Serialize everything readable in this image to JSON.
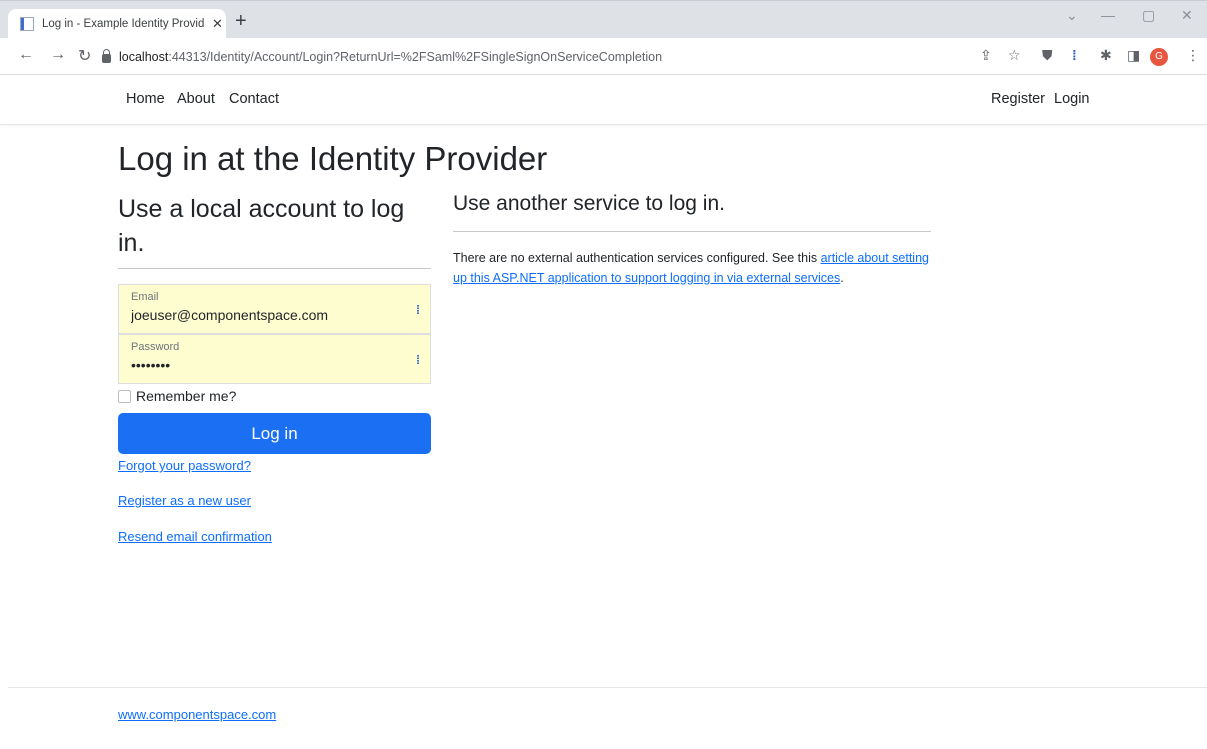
{
  "browser": {
    "tab_title": "Log in - Example Identity Provider",
    "tab_close": "✕",
    "new_tab": "+",
    "url_host": "localhost",
    "url_path": ":44313/Identity/Account/Login?ReturnUrl=%2FSaml%2FSingleSignOnServiceCompletion",
    "avatar_letter": "G",
    "icons": [
      "back-icon",
      "forward-icon",
      "reload-icon",
      "lock-icon",
      "share-icon",
      "star-icon",
      "shield-icon",
      "extension-icon",
      "puzzle-icon",
      "sidepanel-icon",
      "menu-icon"
    ]
  },
  "nav": {
    "home": "Home",
    "about": "About",
    "contact": "Contact",
    "register": "Register",
    "login": "Login"
  },
  "page": {
    "title": "Log in at the Identity Provider",
    "local_heading": "Use a local account to log in.",
    "external_heading": "Use another service to log in.",
    "email_label": "Email",
    "email_value": "joeuser@componentspace.com",
    "password_label": "Password",
    "password_value": "••••••••",
    "remember_label": "Remember me?",
    "login_button": "Log in",
    "forgot_link": "Forgot your password?",
    "register_link": "Register as a new user",
    "resend_link": "Resend email confirmation",
    "external_text": "There are no external authentication services configured. See this ",
    "external_link_1": "article",
    "external_link_2": " about setting up this ASP.NET application to support logging in via external services",
    "external_end": "."
  },
  "footer": {
    "link": "www.componentspace.com"
  },
  "colors": {
    "primary": "#1a6ff3",
    "link": "#0d6efd",
    "autofill": "#fefdd0"
  }
}
